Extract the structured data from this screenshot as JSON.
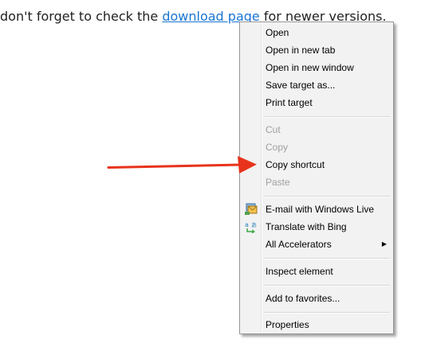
{
  "page": {
    "text_before": "don't forget to check the ",
    "link_text": "download page",
    "text_after": " for newer versions."
  },
  "context_menu": {
    "items": [
      {
        "label": "Open",
        "disabled": false
      },
      {
        "label": "Open in new tab",
        "disabled": false
      },
      {
        "label": "Open in new window",
        "disabled": false
      },
      {
        "label": "Save target as...",
        "disabled": false
      },
      {
        "label": "Print target",
        "disabled": false
      },
      {
        "label": "Cut",
        "disabled": true
      },
      {
        "label": "Copy",
        "disabled": true
      },
      {
        "label": "Copy shortcut",
        "disabled": false
      },
      {
        "label": "Paste",
        "disabled": true
      },
      {
        "label": "E-mail with Windows Live",
        "disabled": false,
        "icon": "windows-live-mail-icon"
      },
      {
        "label": "Translate with Bing",
        "disabled": false,
        "icon": "bing-translate-icon"
      },
      {
        "label": "All Accelerators",
        "disabled": false,
        "submenu": true,
        "submenu_icon": "chevron-right-icon"
      },
      {
        "label": "Inspect element",
        "disabled": false
      },
      {
        "label": "Add to favorites...",
        "disabled": false
      },
      {
        "label": "Properties",
        "disabled": false
      }
    ]
  },
  "annotation": {
    "arrow_color": "#e8331c",
    "arrow_points_to": "Copy shortcut"
  },
  "colors": {
    "link": "#1a75d2",
    "menu_background": "#f2f2f2",
    "disabled_text": "#a0a0a0"
  }
}
